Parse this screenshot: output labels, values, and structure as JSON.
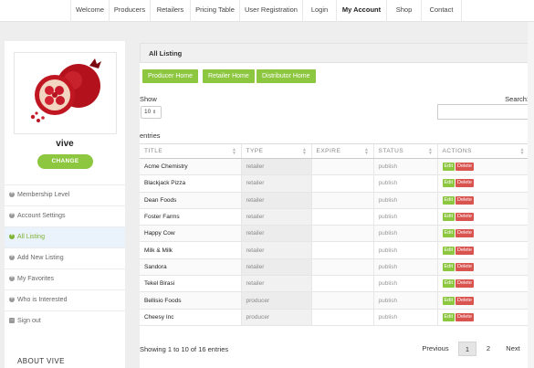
{
  "nav": {
    "items": [
      {
        "label": "Welcome"
      },
      {
        "label": "Producers"
      },
      {
        "label": "Retailers"
      },
      {
        "label": "Pricing Table"
      },
      {
        "label": "User Registration"
      },
      {
        "label": "Login"
      },
      {
        "label": "My Account",
        "active": true
      },
      {
        "label": "Shop"
      },
      {
        "label": "Contact"
      }
    ]
  },
  "sidebar": {
    "avatar_icon": "pomegranate-image",
    "user_name": "vive",
    "change_label": "CHANGE",
    "menu": [
      {
        "label": "Membership Level",
        "icon": "plus-circle-icon"
      },
      {
        "label": "Account Settings",
        "icon": "plus-circle-icon"
      },
      {
        "label": "All Listing",
        "icon": "plus-circle-icon",
        "active": true
      },
      {
        "label": "Add New Listing",
        "icon": "plus-circle-icon"
      },
      {
        "label": "My Favorites",
        "icon": "plus-circle-icon"
      },
      {
        "label": "Who is Interested",
        "icon": "plus-circle-icon"
      },
      {
        "label": "Sign out",
        "icon": "sign-out-icon"
      }
    ],
    "about_label": "ABOUT VIVE"
  },
  "main": {
    "panel_title": "All Listing",
    "tabs": [
      {
        "label": "Producer Home"
      },
      {
        "label": "Retailer Home"
      },
      {
        "label": "Distributor Home"
      }
    ],
    "show_label": "Show",
    "page_length": "10",
    "search_label": "Search:",
    "search_value": "",
    "entries_label": "entries",
    "columns": [
      "TITLE",
      "TYPE",
      "EXPIRE",
      "STATUS",
      "ACTIONS"
    ],
    "edit_label": "Edit",
    "delete_label": "Delete",
    "rows": [
      {
        "title": "Acme Chemistry",
        "type": "retailer",
        "expire": "",
        "status": "publish"
      },
      {
        "title": "Blackjack Pizza",
        "type": "retailer",
        "expire": "",
        "status": "publish"
      },
      {
        "title": "Dean Foods",
        "type": "retailer",
        "expire": "",
        "status": "publish"
      },
      {
        "title": "Foster Farms",
        "type": "retailer",
        "expire": "",
        "status": "publish"
      },
      {
        "title": "Happy Cow",
        "type": "retailer",
        "expire": "",
        "status": "publish"
      },
      {
        "title": "Milk & Milk",
        "type": "retailer",
        "expire": "",
        "status": "publish"
      },
      {
        "title": "Sandora",
        "type": "retailer",
        "expire": "",
        "status": "publish"
      },
      {
        "title": "Tekel Birasi",
        "type": "retailer",
        "expire": "",
        "status": "publish"
      },
      {
        "title": "Bellisio Foods",
        "type": "producer",
        "expire": "",
        "status": "publish"
      },
      {
        "title": "Cheesy Inc",
        "type": "producer",
        "expire": "",
        "status": "publish"
      }
    ],
    "info_text": "Showing 1 to 10 of 16 entries",
    "pagination": {
      "previous": "Previous",
      "pages": [
        "1",
        "2"
      ],
      "current": "1",
      "next": "Next"
    }
  },
  "colors": {
    "accent_green": "#8dc63f",
    "delete_red": "#d9534f"
  }
}
